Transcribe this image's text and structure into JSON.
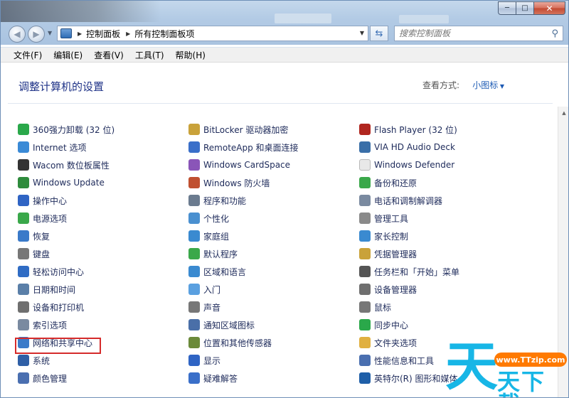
{
  "window": {
    "caption_buttons": {
      "minimize": "─",
      "maximize": "□",
      "close": "✕"
    }
  },
  "nav": {
    "back_glyph": "◀",
    "forward_glyph": "▶",
    "breadcrumb": [
      "控制面板",
      "所有控制面板项"
    ],
    "search_placeholder": "搜索控制面板"
  },
  "menu": [
    "文件(F)",
    "编辑(E)",
    "查看(V)",
    "工具(T)",
    "帮助(H)"
  ],
  "header": {
    "title": "调整计算机的设置",
    "view_by_label": "查看方式:",
    "view_by_value": "小图标"
  },
  "columns": [
    [
      {
        "label": "360强力卸载 (32 位)",
        "icon": "uninstall-icon",
        "color": "#2aa84a"
      },
      {
        "label": "Internet 选项",
        "icon": "internet-options-icon",
        "color": "#3a8ad6"
      },
      {
        "label": "Wacom 数位板属性",
        "icon": "wacom-tablet-icon",
        "color": "#333333"
      },
      {
        "label": "Windows Update",
        "icon": "windows-update-icon",
        "color": "#2e8b3c"
      },
      {
        "label": "操作中心",
        "icon": "action-center-flag-icon",
        "color": "#2f64c4"
      },
      {
        "label": "电源选项",
        "icon": "power-options-icon",
        "color": "#3aa84a"
      },
      {
        "label": "恢复",
        "icon": "recovery-icon",
        "color": "#3a7ac9"
      },
      {
        "label": "键盘",
        "icon": "keyboard-icon",
        "color": "#777777"
      },
      {
        "label": "轻松访问中心",
        "icon": "ease-of-access-icon",
        "color": "#2f6cc4"
      },
      {
        "label": "日期和时间",
        "icon": "date-time-icon",
        "color": "#5a7fa8"
      },
      {
        "label": "设备和打印机",
        "icon": "devices-printers-icon",
        "color": "#6f6f6f"
      },
      {
        "label": "索引选项",
        "icon": "indexing-options-icon",
        "color": "#7a8aa0"
      },
      {
        "label": "网络和共享中心",
        "icon": "network-sharing-icon",
        "color": "#3b7bc9"
      },
      {
        "label": "系统",
        "icon": "system-icon",
        "color": "#2f5fa6"
      },
      {
        "label": "颜色管理",
        "icon": "color-management-icon",
        "color": "#4a6fb0"
      }
    ],
    [
      {
        "label": "BitLocker 驱动器加密",
        "icon": "bitlocker-icon",
        "color": "#c9a23a"
      },
      {
        "label": "RemoteApp 和桌面连接",
        "icon": "remoteapp-icon",
        "color": "#3a6fc9"
      },
      {
        "label": "Windows CardSpace",
        "icon": "cardspace-icon",
        "color": "#8a55b8"
      },
      {
        "label": "Windows 防火墙",
        "icon": "firewall-icon",
        "color": "#c05030"
      },
      {
        "label": "程序和功能",
        "icon": "programs-features-icon",
        "color": "#6b7b8f"
      },
      {
        "label": "个性化",
        "icon": "personalization-icon",
        "color": "#4a90d0"
      },
      {
        "label": "家庭组",
        "icon": "homegroup-icon",
        "color": "#3a8ad0"
      },
      {
        "label": "默认程序",
        "icon": "default-programs-icon",
        "color": "#3aa84a"
      },
      {
        "label": "区域和语言",
        "icon": "region-language-icon",
        "color": "#3a8ad0"
      },
      {
        "label": "入门",
        "icon": "getting-started-icon",
        "color": "#5aa0e0"
      },
      {
        "label": "声音",
        "icon": "sound-icon",
        "color": "#777777"
      },
      {
        "label": "通知区域图标",
        "icon": "notification-area-icon",
        "color": "#4a6fa8"
      },
      {
        "label": "位置和其他传感器",
        "icon": "location-sensors-icon",
        "color": "#6b8a3a"
      },
      {
        "label": "显示",
        "icon": "display-icon",
        "color": "#2f64c4"
      },
      {
        "label": "疑难解答",
        "icon": "troubleshooting-icon",
        "color": "#3a6fc9"
      }
    ],
    [
      {
        "label": "Flash Player (32 位)",
        "icon": "flash-player-icon",
        "color": "#b0261f"
      },
      {
        "label": "VIA HD Audio Deck",
        "icon": "via-audio-icon",
        "color": "#3a6fa8"
      },
      {
        "label": "Windows Defender",
        "icon": "windows-defender-icon",
        "color": "#e8e8e8"
      },
      {
        "label": "备份和还原",
        "icon": "backup-restore-icon",
        "color": "#3aa84a"
      },
      {
        "label": "电话和调制解调器",
        "icon": "phone-modem-icon",
        "color": "#7a8aa0"
      },
      {
        "label": "管理工具",
        "icon": "admin-tools-icon",
        "color": "#8a8a8a"
      },
      {
        "label": "家长控制",
        "icon": "parental-controls-icon",
        "color": "#3a8ad0"
      },
      {
        "label": "凭据管理器",
        "icon": "credential-manager-icon",
        "color": "#c9a23a"
      },
      {
        "label": "任务栏和「开始」菜单",
        "icon": "taskbar-start-icon",
        "color": "#555555"
      },
      {
        "label": "设备管理器",
        "icon": "device-manager-icon",
        "color": "#6f6f6f"
      },
      {
        "label": "鼠标",
        "icon": "mouse-icon",
        "color": "#777777"
      },
      {
        "label": "同步中心",
        "icon": "sync-center-icon",
        "color": "#2aa84a"
      },
      {
        "label": "文件夹选项",
        "icon": "folder-options-icon",
        "color": "#e0b040"
      },
      {
        "label": "性能信息和工具",
        "icon": "performance-icon",
        "color": "#4a6fb0"
      },
      {
        "label": "英特尔(R) 图形和媒体",
        "icon": "intel-graphics-icon",
        "color": "#1f5fa8"
      }
    ]
  ],
  "watermark": {
    "glyph": "天",
    "badge": "www.TTzip.com",
    "text": "天下載"
  }
}
